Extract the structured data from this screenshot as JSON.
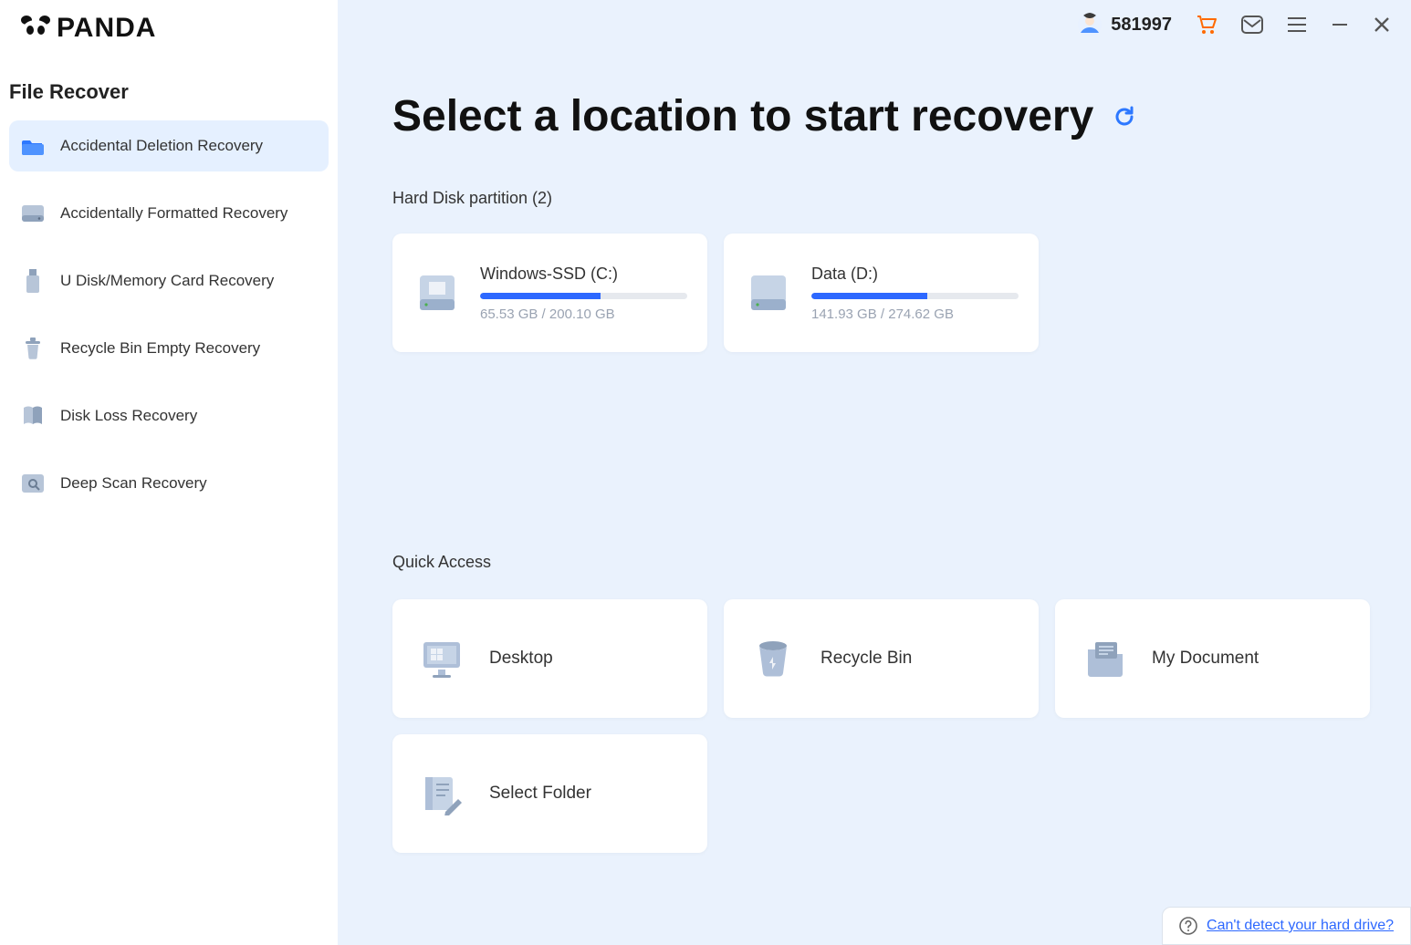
{
  "brand": {
    "name": "PANDA"
  },
  "sidebar": {
    "section_title": "File Recover",
    "items": [
      {
        "label": "Accidental Deletion Recovery",
        "icon": "folder-icon",
        "active": true
      },
      {
        "label": "Accidentally Formatted Recovery",
        "icon": "drive-icon",
        "active": false
      },
      {
        "label": "U Disk/Memory Card Recovery",
        "icon": "usb-icon",
        "active": false
      },
      {
        "label": "Recycle Bin Empty Recovery",
        "icon": "trash-icon",
        "active": false
      },
      {
        "label": "Disk Loss Recovery",
        "icon": "book-icon",
        "active": false
      },
      {
        "label": "Deep Scan Recovery",
        "icon": "scan-icon",
        "active": false
      }
    ]
  },
  "topbar": {
    "user_id": "581997"
  },
  "main": {
    "title": "Select a location to start recovery",
    "partitions_heading": "Hard Disk partition   (2)",
    "partitions": [
      {
        "name": "Windows-SSD   (C:)",
        "used": "65.53 GB",
        "total": "200.10 GB",
        "percent": 58
      },
      {
        "name": "Data   (D:)",
        "used": "141.93 GB",
        "total": "274.62 GB",
        "percent": 56
      }
    ],
    "quick_heading": "Quick Access",
    "quick": [
      {
        "label": "Desktop",
        "icon": "monitor-icon"
      },
      {
        "label": "Recycle Bin",
        "icon": "bin-icon"
      },
      {
        "label": "My Document",
        "icon": "document-icon"
      },
      {
        "label": "Select Folder",
        "icon": "folder-edit-icon"
      }
    ]
  },
  "help": {
    "text": "Can't detect your hard drive?"
  },
  "size_sep": " / "
}
